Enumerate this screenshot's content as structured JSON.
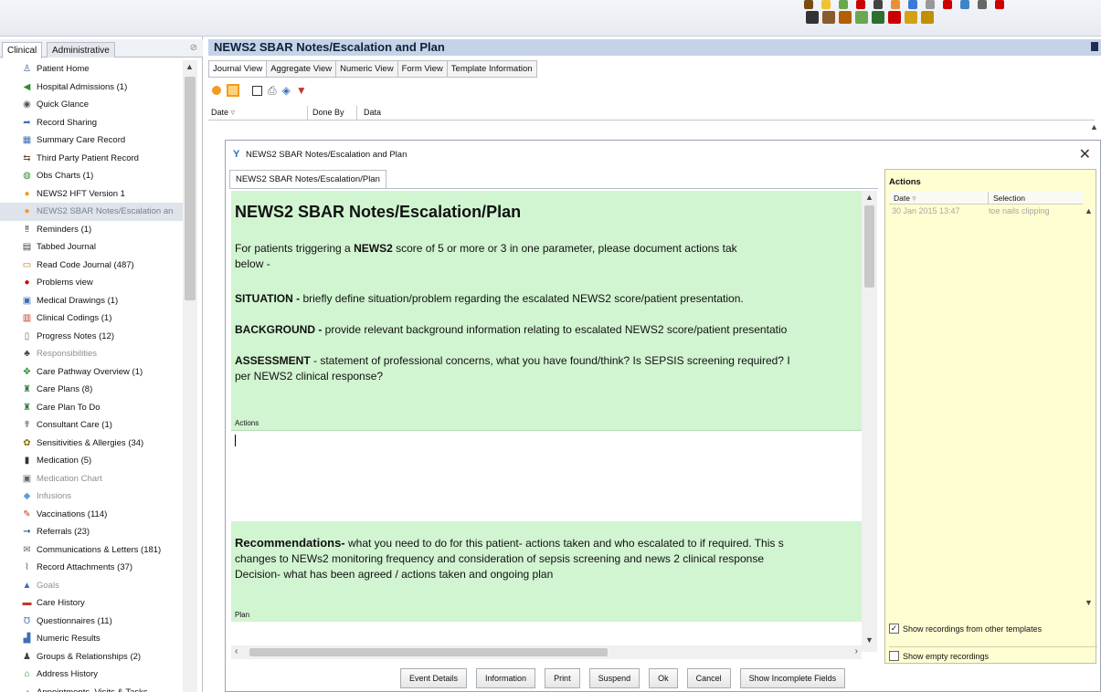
{
  "toolbar": {
    "icons_row1": [
      "#7a4a10",
      "#f1c232",
      "#6aa84f",
      "#cc0000",
      "#444444",
      "#e69138",
      "#3c78d8",
      "#999999",
      "#cc0000",
      "#3d85c6",
      "#666666",
      "#cc0000"
    ],
    "icons_row2": [
      "#333333",
      "#8b5a2b",
      "#b45f06",
      "#6aa84f",
      "#2f6f2f",
      "#cc0000",
      "#d4a017",
      "#bf9000"
    ]
  },
  "left": {
    "tabs": [
      "Clinical",
      "Administrative"
    ],
    "items": [
      {
        "label": "Patient Home",
        "icon": "person-icon",
        "glyph": "♙",
        "color": "#3b5998"
      },
      {
        "label": "Hospital Admissions (1)",
        "icon": "hospital-icon",
        "glyph": "◀",
        "color": "#2e8b2e"
      },
      {
        "label": "Quick Glance",
        "icon": "eye-icon",
        "glyph": "◉",
        "color": "#555555"
      },
      {
        "label": "Record Sharing",
        "icon": "share-icon",
        "glyph": "➦",
        "color": "#3d6fb5"
      },
      {
        "label": "Summary Care Record",
        "icon": "summary-record-icon",
        "glyph": "▦",
        "color": "#3d6fb5"
      },
      {
        "label": "Third Party Patient Record",
        "icon": "third-party-icon",
        "glyph": "⇆",
        "color": "#6a4a2a"
      },
      {
        "label": "Obs Charts (1)",
        "icon": "obs-chart-icon",
        "glyph": "◍",
        "color": "#2e8b2e"
      },
      {
        "label": "NEWS2  HFT Version 1",
        "icon": "orange-dot-icon",
        "glyph": "●",
        "color": "#f29c1f"
      },
      {
        "label": "NEWS2 SBAR Notes/Escalation an",
        "icon": "orange-dot-icon",
        "glyph": "●",
        "color": "#f29c1f",
        "selected": true
      },
      {
        "label": "Reminders (1)",
        "icon": "reminder-icon",
        "glyph": "‼",
        "color": "#222222"
      },
      {
        "label": "Tabbed Journal",
        "icon": "journal-icon",
        "glyph": "▤",
        "color": "#444444"
      },
      {
        "label": "Read Code Journal (487)",
        "icon": "read-code-icon",
        "glyph": "▭",
        "color": "#b47a1e"
      },
      {
        "label": "Problems view",
        "icon": "red-dot-icon",
        "glyph": "●",
        "color": "#d40000"
      },
      {
        "label": "Medical Drawings (1)",
        "icon": "drawing-icon",
        "glyph": "▣",
        "color": "#3d6fb5"
      },
      {
        "label": "Clinical Codings (1)",
        "icon": "coding-icon",
        "glyph": "▥",
        "color": "#c0392b"
      },
      {
        "label": "Progress Notes (12)",
        "icon": "notes-icon",
        "glyph": "▯",
        "color": "#666666"
      },
      {
        "label": "Responsibilities",
        "icon": "responsibility-icon",
        "glyph": "♣",
        "color": "#444444",
        "dim": true
      },
      {
        "label": "Care Pathway Overview (1)",
        "icon": "pathway-icon",
        "glyph": "✥",
        "color": "#2e8b2e"
      },
      {
        "label": "Care Plans (8)",
        "icon": "care-plan-icon",
        "glyph": "♜",
        "color": "#2e7d32"
      },
      {
        "label": "Care Plan To Do",
        "icon": "care-plan-todo-icon",
        "glyph": "♜",
        "color": "#2e7d32"
      },
      {
        "label": "Consultant Care (1)",
        "icon": "consultant-icon",
        "glyph": "☤",
        "color": "#555555"
      },
      {
        "label": "Sensitivities & Allergies (34)",
        "icon": "allergy-icon",
        "glyph": "✿",
        "color": "#8e6d00"
      },
      {
        "label": "Medication (5)",
        "icon": "medication-icon",
        "glyph": "▮",
        "color": "#333333"
      },
      {
        "label": "Medication Chart",
        "icon": "medication-chart-icon",
        "glyph": "▣",
        "color": "#666666",
        "dim": true
      },
      {
        "label": "Infusions",
        "icon": "infusion-icon",
        "glyph": "◆",
        "color": "#5aa0d8",
        "dim": true
      },
      {
        "label": "Vaccinations (114)",
        "icon": "syringe-icon",
        "glyph": "✎",
        "color": "#c0392b"
      },
      {
        "label": "Referrals (23)",
        "icon": "referral-arrow-icon",
        "glyph": "➞",
        "color": "#1f3f9f"
      },
      {
        "label": "Communications & Letters (181)",
        "icon": "letter-icon",
        "glyph": "✉",
        "color": "#666666"
      },
      {
        "label": "Record Attachments (37)",
        "icon": "attachment-icon",
        "glyph": "⌇",
        "color": "#666666"
      },
      {
        "label": "Goals",
        "icon": "goal-icon",
        "glyph": "▲",
        "color": "#3d6fb5",
        "dim": true
      },
      {
        "label": "Care History",
        "icon": "care-history-icon",
        "glyph": "▬",
        "color": "#c0392b"
      },
      {
        "label": "Questionnaires (11)",
        "icon": "questionnaire-icon",
        "glyph": "Ʊ",
        "color": "#3d6fb5"
      },
      {
        "label": "Numeric Results",
        "icon": "numeric-results-icon",
        "glyph": "▟",
        "color": "#3d6fb5"
      },
      {
        "label": "Groups & Relationships (2)",
        "icon": "groups-icon",
        "glyph": "♟",
        "color": "#444444"
      },
      {
        "label": "Address History",
        "icon": "address-icon",
        "glyph": "⌂",
        "color": "#2e8b2e"
      },
      {
        "label": "Appointments, Visits & Tasks",
        "icon": "appointments-icon",
        "glyph": "◔",
        "color": "#d4a017"
      }
    ]
  },
  "main": {
    "title": "NEWS2 SBAR Notes/Escalation and Plan",
    "tabs": [
      "Journal View",
      "Aggregate View",
      "Numeric View",
      "Form View",
      "Template Information"
    ],
    "columns": {
      "date": "Date",
      "done_by": "Done By",
      "data": "Data"
    }
  },
  "dialog": {
    "title": "NEWS2 SBAR Notes/Escalation and Plan",
    "tab": "NEWS2 SBAR Notes/Escalation/Plan",
    "form": {
      "heading": "NEWS2 SBAR Notes/Escalation/Plan",
      "intro_a": "For patients triggering a ",
      "intro_bold": "NEWS2",
      "intro_b": " score of 5 or more or 3 in one parameter, please document actions tak",
      "intro_c": "below -",
      "situation_label": "SITUATION - ",
      "situation_text": "briefly define situation/problem regarding the escalated NEWS2 score/patient presentation.",
      "background_label": "BACKGROUND - ",
      "background_text": "provide relevant background information relating to escalated NEWS2 score/patient presentatio",
      "assessment_label": "ASSESSMENT",
      "assessment_text": " - statement of professional concerns, what you have found/think? Is SEPSIS screening required? I",
      "assessment_text_2": "per NEWS2 clinical response?",
      "actions_label": "Actions",
      "rec_label": "Recommendations-",
      "rec_text": " what you need to do for this patient- actions taken and who escalated to if required. This s",
      "rec_text_2": "changes to NEWs2 monitoring frequency and consideration of sepsis screening  and news 2 clinical response",
      "rec_text_3": "Decision- what has been agreed / actions taken and ongoing plan",
      "plan_label": "Plan"
    },
    "side": {
      "title": "Actions",
      "col_date": "Date",
      "col_selection": "Selection",
      "row_date": "30 Jan 2015 13:47",
      "row_selection": "toe nails clipping",
      "show_other": "Show recordings from other templates",
      "show_other_checked": true,
      "show_empty": "Show empty recordings",
      "show_empty_checked": false
    },
    "buttons": [
      "Event Details",
      "Information",
      "Print",
      "Suspend",
      "Ok",
      "Cancel",
      "Show Incomplete Fields"
    ]
  }
}
